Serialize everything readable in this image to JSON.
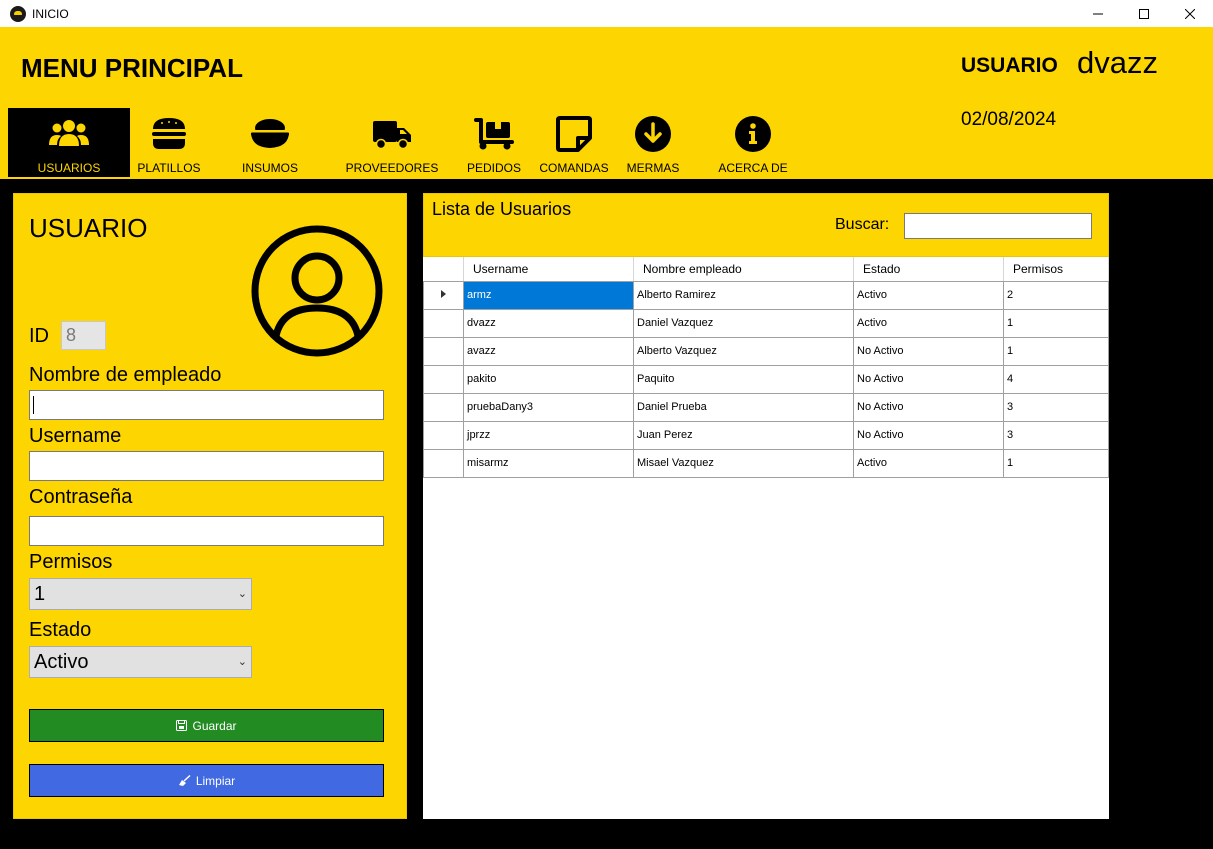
{
  "window": {
    "title": "INICIO"
  },
  "header": {
    "title": "MENU PRINCIPAL",
    "user_label": "USUARIO",
    "user_name": "dvazz",
    "date": "02/08/2024"
  },
  "nav": {
    "items": [
      {
        "label": "USUARIOS",
        "icon": "users-icon",
        "active": true
      },
      {
        "label": "PLATILLOS",
        "icon": "burger-icon"
      },
      {
        "label": "INSUMOS",
        "icon": "bowl-icon"
      },
      {
        "label": "PROVEEDORES",
        "icon": "truck-icon"
      },
      {
        "label": "PEDIDOS",
        "icon": "dolly-icon"
      },
      {
        "label": "COMANDAS",
        "icon": "note-icon"
      },
      {
        "label": "MERMAS",
        "icon": "arrow-down-circle-icon"
      },
      {
        "label": "ACERCA DE",
        "icon": "info-circle-icon"
      }
    ]
  },
  "form": {
    "title": "USUARIO",
    "id_label": "ID",
    "id_value": "8",
    "employee_label": "Nombre de empleado",
    "employee_value": "",
    "username_label": "Username",
    "username_value": "",
    "password_label": "Contraseña",
    "password_value": "",
    "permisos_label": "Permisos",
    "permisos_value": "1",
    "estado_label": "Estado",
    "estado_value": "Activo",
    "save_label": "Guardar",
    "clear_label": "Limpiar",
    "colors": {
      "panel": "#fdd500",
      "save": "#228b22",
      "clear": "#4169e1"
    }
  },
  "list": {
    "title": "Lista de Usuarios",
    "search_label": "Buscar:",
    "search_value": "",
    "columns": [
      "Username",
      "Nombre empleado",
      "Estado",
      "Permisos"
    ],
    "rows": [
      [
        "armz",
        "Alberto Ramirez",
        "Activo",
        "2"
      ],
      [
        "dvazz",
        "Daniel Vazquez",
        "Activo",
        "1"
      ],
      [
        "avazz",
        "Alberto Vazquez",
        "No Activo",
        "1"
      ],
      [
        "pakito",
        "Paquito",
        "No Activo",
        "4"
      ],
      [
        "pruebaDany3",
        "Daniel Prueba",
        "No Activo",
        "3"
      ],
      [
        "jprzz",
        "Juan Perez",
        "No Activo",
        "3"
      ],
      [
        "misarmz",
        "Misael Vazquez",
        "Activo",
        "1"
      ]
    ],
    "selected_row": 0,
    "selection_color": "#0078d7"
  }
}
